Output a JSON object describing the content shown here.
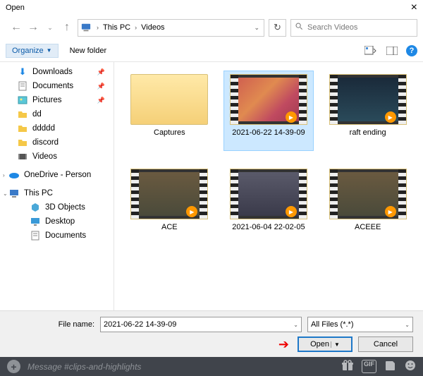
{
  "title": "Open",
  "breadcrumb": {
    "root": "This PC",
    "folder": "Videos"
  },
  "search": {
    "placeholder": "Search Videos"
  },
  "toolbar": {
    "organize": "Organize",
    "newfolder": "New folder"
  },
  "sidebar": {
    "quick": [
      {
        "label": "Downloads",
        "pinned": true
      },
      {
        "label": "Documents",
        "pinned": true
      },
      {
        "label": "Pictures",
        "pinned": true
      },
      {
        "label": "dd",
        "pinned": false
      },
      {
        "label": "ddddd",
        "pinned": false
      },
      {
        "label": "discord",
        "pinned": false
      },
      {
        "label": "Videos",
        "pinned": false
      }
    ],
    "onedrive": "OneDrive - Person",
    "thispc": "This PC",
    "pc_children": [
      "3D Objects",
      "Desktop",
      "Documents"
    ]
  },
  "files": [
    {
      "label": "Captures",
      "type": "folder"
    },
    {
      "label": "2021-06-22 14-39-09",
      "type": "video",
      "variant": "a",
      "selected": true
    },
    {
      "label": "raft ending",
      "type": "video",
      "variant": "b"
    },
    {
      "label": "ACE",
      "type": "video",
      "variant": "c"
    },
    {
      "label": "2021-06-04 22-02-05",
      "type": "video",
      "variant": "d"
    },
    {
      "label": "ACEEE",
      "type": "video",
      "variant": "c"
    }
  ],
  "filename": {
    "label": "File name:",
    "value": "2021-06-22 14-39-09"
  },
  "filter": "All Files (*.*)",
  "buttons": {
    "open": "Open",
    "cancel": "Cancel"
  },
  "discord": {
    "placeholder": "Message #clips-and-highlights",
    "gif": "GIF"
  }
}
